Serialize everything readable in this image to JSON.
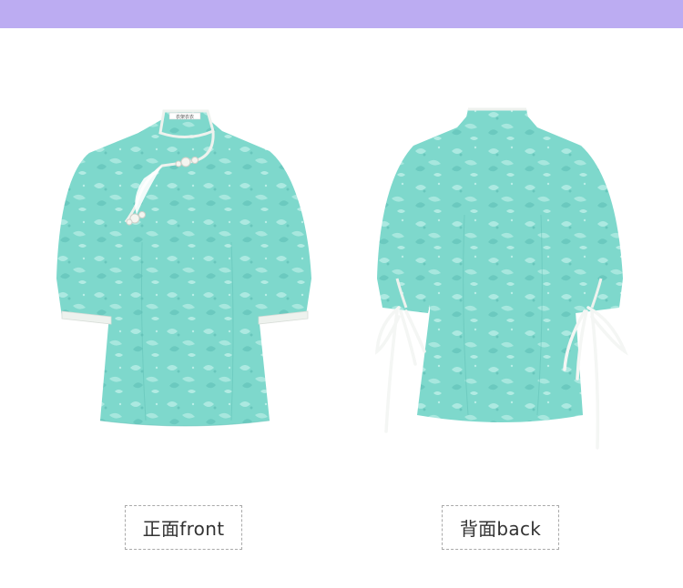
{
  "colors": {
    "banner": "#bcacf2",
    "fabric": "#7ed8cc",
    "fabric_light": "#b8eee6",
    "fabric_dark": "#5fc0b6",
    "trim": "#eef2ee",
    "label_border": "#a9a9a9",
    "label_text": "#333333"
  },
  "views": [
    {
      "label": "正面front",
      "icon": "front-view-shirt-illustration"
    },
    {
      "label": "背面back",
      "icon": "back-view-shirt-illustration"
    }
  ],
  "brand_tag": "衣架衣衣"
}
